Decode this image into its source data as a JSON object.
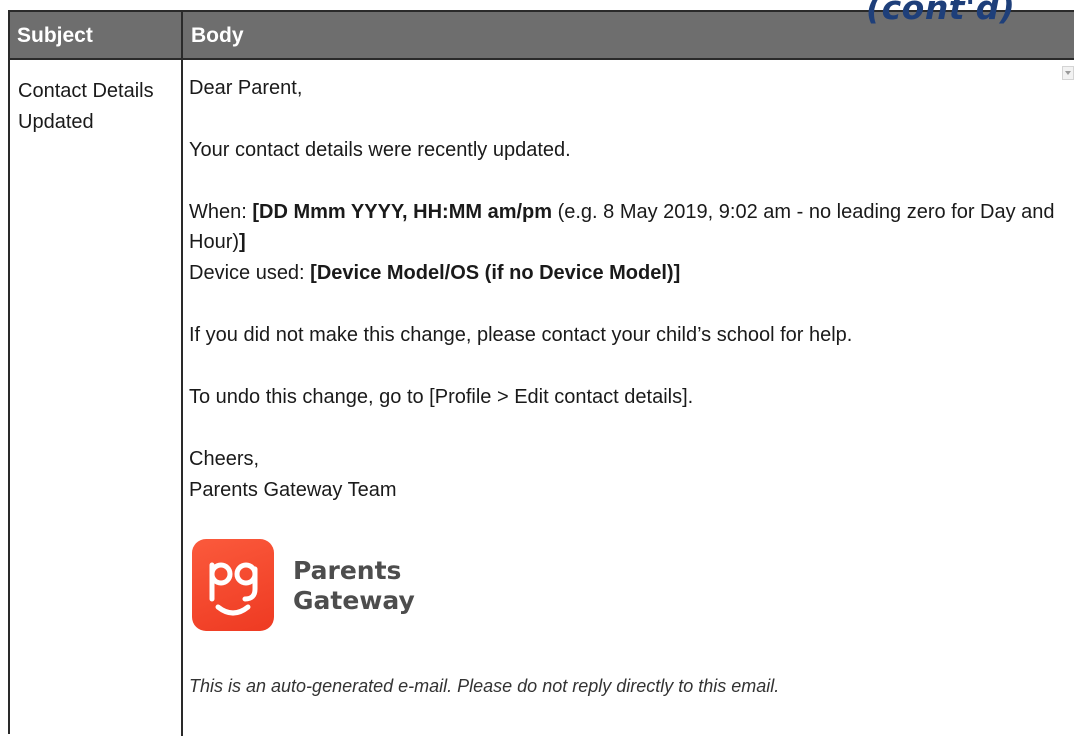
{
  "page": {
    "corner_label": "(cont'd)"
  },
  "table": {
    "headers": [
      "Subject",
      "Body"
    ],
    "subject": "Contact Details Updated"
  },
  "email": {
    "greeting": "Dear Parent,",
    "intro": "Your contact details were recently updated.",
    "when_label": "When: ",
    "when_value": "[DD Mmm YYYY, HH:MM am/pm",
    "when_note": " (e.g. 8 May 2019, 9:02 am - no leading zero for Day and",
    "when_note_cont": "Hour)",
    "when_close": "]",
    "device_label": "Device used: ",
    "device_value": "[Device Model/OS (if no Device Model)]",
    "warning": "If you did not make this change, please contact your child’s school for help.",
    "undo": "To undo this change, go to [Profile > Edit contact details].",
    "signoff": "Cheers,",
    "team": "Parents Gateway Team",
    "footer": "This is an auto-generated e-mail. Please do not reply directly to this email."
  },
  "logo": {
    "line1": "Parents",
    "line2": "Gateway",
    "brand_color": "#f04a2d"
  }
}
